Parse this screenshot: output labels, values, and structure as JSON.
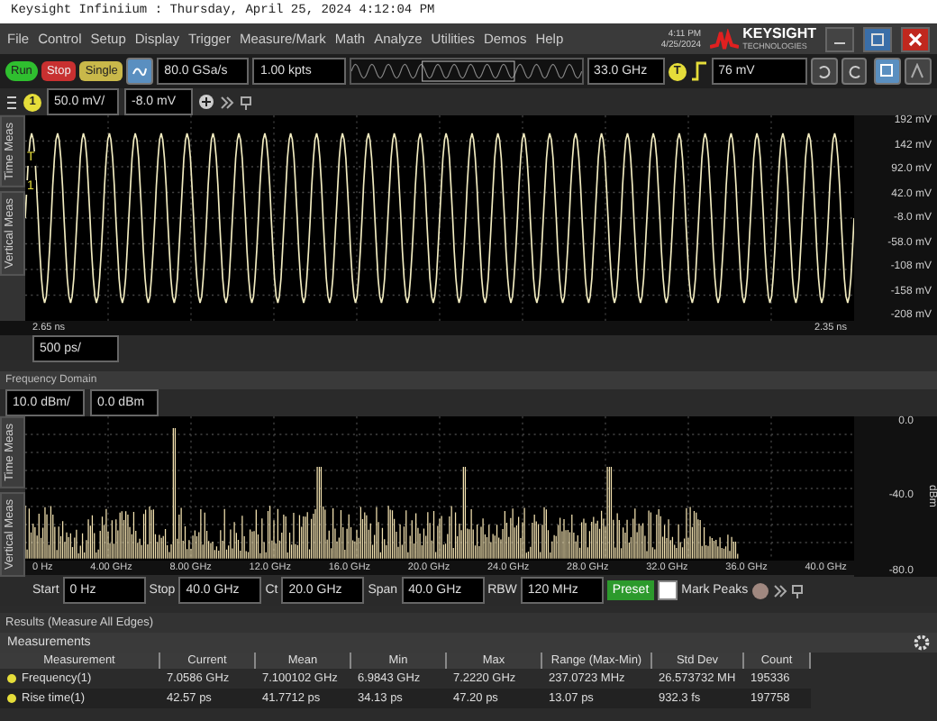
{
  "title_bar": {
    "text": "Keysight Infiniium : Thursday, April 25, 2024 4:12:04 PM"
  },
  "menu": [
    "File",
    "Control",
    "Setup",
    "Display",
    "Trigger",
    "Measure/Mark",
    "Math",
    "Analyze",
    "Utilities",
    "Demos",
    "Help"
  ],
  "clock": {
    "time": "4:11 PM",
    "date": "4/25/2024"
  },
  "logo": {
    "name": "KEYSIGHT",
    "subtitle": "TECHNOLOGIES"
  },
  "toolbar": {
    "buttons": [
      {
        "label": "Run",
        "kind": "run"
      },
      {
        "label": "Stop",
        "kind": "stop"
      },
      {
        "label": "Single",
        "kind": "single"
      }
    ],
    "sample_rate": "80.0 GSa/s",
    "memory_depth": "1.00 kpts",
    "bandwidth": "33.0 GHz",
    "trigger_badge": "T",
    "trigger_level": "76 mV"
  },
  "channel": {
    "badge": "1",
    "scale": "50.0 mV/",
    "offset": "-8.0 mV"
  },
  "time_domain": {
    "side_tabs": [
      "Time Meas",
      "Vertical Meas"
    ],
    "markers": [
      "T",
      "1"
    ],
    "y_labels": [
      "192 mV",
      "142 mV",
      "92.0 mV",
      "42.0 mV",
      "-8.0 mV",
      "-58.0 mV",
      "-108 mV",
      "-158 mV",
      "-208 mV"
    ],
    "x_labels": [
      "2.65 ns",
      "2.35 ns"
    ],
    "timebase": "500 ps/"
  },
  "frequency_domain": {
    "title": "Frequency Domain",
    "scale": "10.0 dBm/",
    "offset": "0.0 dBm",
    "side_tabs": [
      "Time Meas",
      "Vertical Meas"
    ],
    "y_labels": [
      "0.0",
      "-40.0",
      "-80.0"
    ],
    "y_unit": "dBm",
    "x_labels": [
      "0 Hz",
      "4.00 GHz",
      "8.00 GHz",
      "12.0 GHz",
      "16.0 GHz",
      "20.0 GHz",
      "24.0 GHz",
      "28.0 GHz",
      "32.0 GHz",
      "36.0 GHz",
      "40.0 GHz"
    ],
    "controls": [
      {
        "label": "Start",
        "value": "0 Hz"
      },
      {
        "label": "Stop",
        "value": "40.0 GHz"
      },
      {
        "label": "Ct",
        "value": "20.0 GHz"
      },
      {
        "label": "Span",
        "value": "40.0 GHz"
      },
      {
        "label": "RBW",
        "value": "120 MHz"
      }
    ],
    "preset": "Preset",
    "mark_peaks": {
      "label": "Mark Peaks",
      "checked": false
    }
  },
  "results": {
    "title": "Results  (Measure All Edges)",
    "tab": "Measurements",
    "columns": [
      "Measurement",
      "Current",
      "Mean",
      "Min",
      "Max",
      "Range (Max-Min)",
      "Std Dev",
      "Count"
    ],
    "rows": [
      [
        "Frequency(1)",
        "7.0586 GHz",
        "7.100102 GHz",
        "6.9843 GHz",
        "7.2220 GHz",
        "237.0723 MHz",
        "26.573732 MH",
        "195336"
      ],
      [
        "Rise time(1)",
        "42.57 ps",
        "41.7712 ps",
        "34.13 ps",
        "47.20 ps",
        "13.07 ps",
        "932.3 fs",
        "197758"
      ]
    ]
  }
}
